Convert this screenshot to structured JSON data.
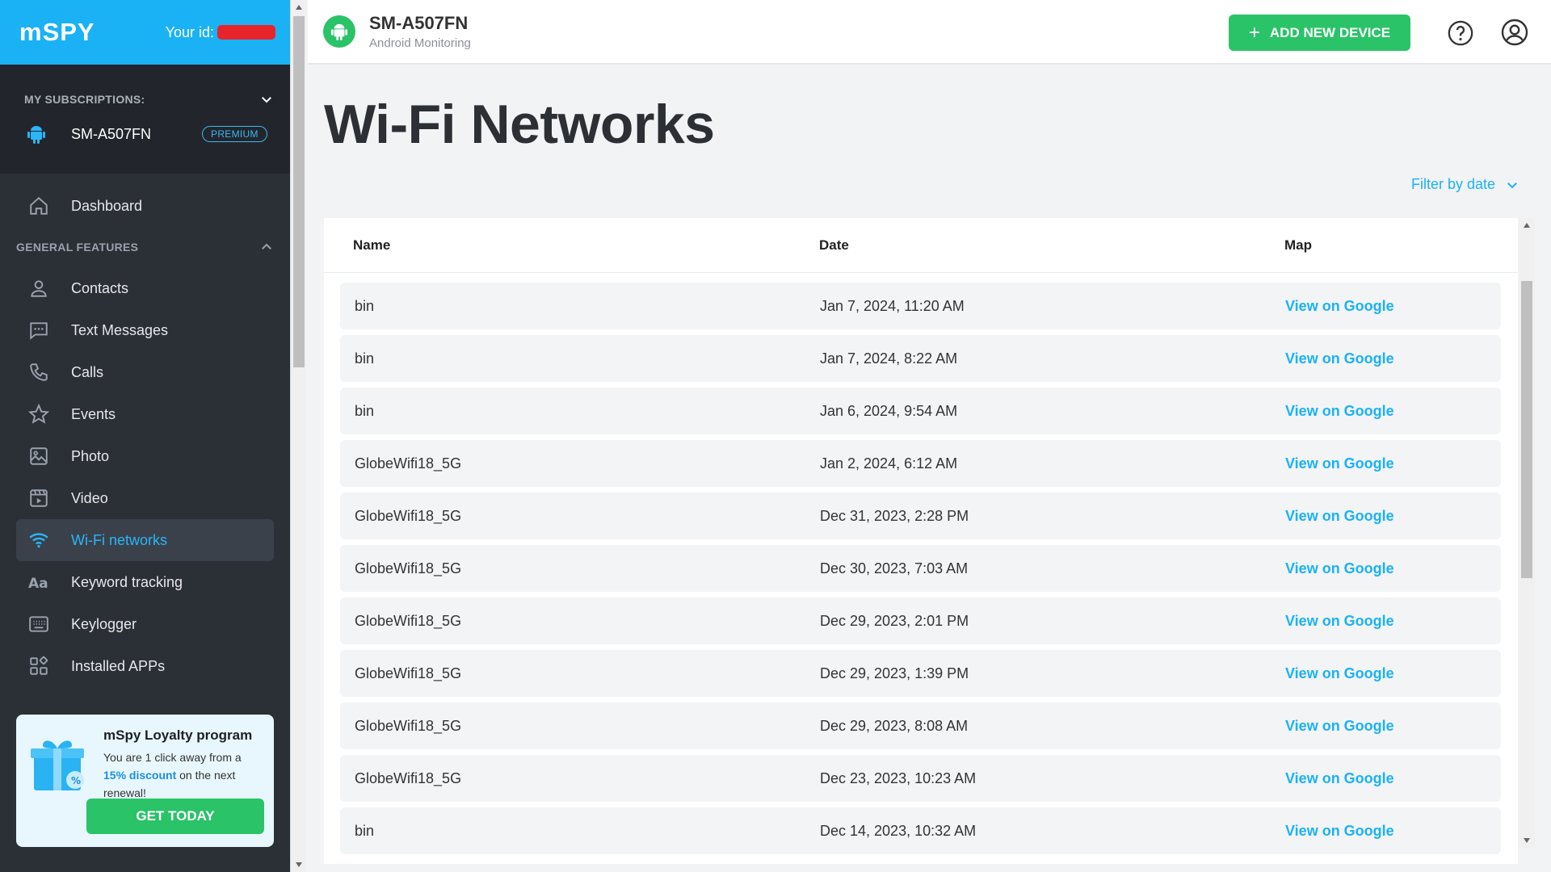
{
  "sidebar": {
    "brand": "mSPY",
    "your_id_label": "Your id:",
    "subscriptions_label": "MY SUBSCRIPTIONS:",
    "device_name": "SM-A507FN",
    "device_badge": "PREMIUM",
    "dashboard_label": "Dashboard",
    "section_label": "GENERAL FEATURES",
    "items": [
      {
        "label": "Contacts",
        "icon": "person-icon"
      },
      {
        "label": "Text Messages",
        "icon": "message-icon"
      },
      {
        "label": "Calls",
        "icon": "phone-icon"
      },
      {
        "label": "Events",
        "icon": "star-icon"
      },
      {
        "label": "Photo",
        "icon": "image-icon"
      },
      {
        "label": "Video",
        "icon": "video-icon"
      },
      {
        "label": "Wi-Fi networks",
        "icon": "wifi-icon",
        "active": true
      },
      {
        "label": "Keyword tracking",
        "icon": "text-icon"
      },
      {
        "label": "Keylogger",
        "icon": "keyboard-icon"
      },
      {
        "label": "Installed APPs",
        "icon": "apps-icon"
      }
    ],
    "loyalty": {
      "title": "mSpy Loyalty program",
      "text_before": "You are 1 click away from a",
      "discount": "15% discount",
      "text_after": "on the next renewal!",
      "button": "GET TODAY"
    }
  },
  "topbar": {
    "device_name": "SM-A507FN",
    "device_subtitle": "Android Monitoring",
    "add_button": "ADD NEW DEVICE"
  },
  "main": {
    "title": "Wi-Fi Networks",
    "filter_label": "Filter by date",
    "columns": {
      "name": "Name",
      "date": "Date",
      "map": "Map"
    },
    "rows": [
      {
        "name": "bin",
        "date": "Jan 7, 2024, 11:20 AM",
        "map": "View on Google"
      },
      {
        "name": "bin",
        "date": "Jan 7, 2024, 8:22 AM",
        "map": "View on Google"
      },
      {
        "name": "bin",
        "date": "Jan 6, 2024, 9:54 AM",
        "map": "View on Google"
      },
      {
        "name": "GlobeWifi18_5G",
        "date": "Jan 2, 2024, 6:12 AM",
        "map": "View on Google"
      },
      {
        "name": "GlobeWifi18_5G",
        "date": "Dec 31, 2023, 2:28 PM",
        "map": "View on Google"
      },
      {
        "name": "GlobeWifi18_5G",
        "date": "Dec 30, 2023, 7:03 AM",
        "map": "View on Google"
      },
      {
        "name": "GlobeWifi18_5G",
        "date": "Dec 29, 2023, 2:01 PM",
        "map": "View on Google"
      },
      {
        "name": "GlobeWifi18_5G",
        "date": "Dec 29, 2023, 1:39 PM",
        "map": "View on Google"
      },
      {
        "name": "GlobeWifi18_5G",
        "date": "Dec 29, 2023, 8:08 AM",
        "map": "View on Google"
      },
      {
        "name": "GlobeWifi18_5G",
        "date": "Dec 23, 2023, 10:23 AM",
        "map": "View on Google"
      },
      {
        "name": "bin",
        "date": "Dec 14, 2023, 10:32 AM",
        "map": "View on Google"
      }
    ]
  },
  "colors": {
    "accent": "#1ab2f5",
    "green": "#2ac368",
    "sidebar": "#2b2f36"
  }
}
